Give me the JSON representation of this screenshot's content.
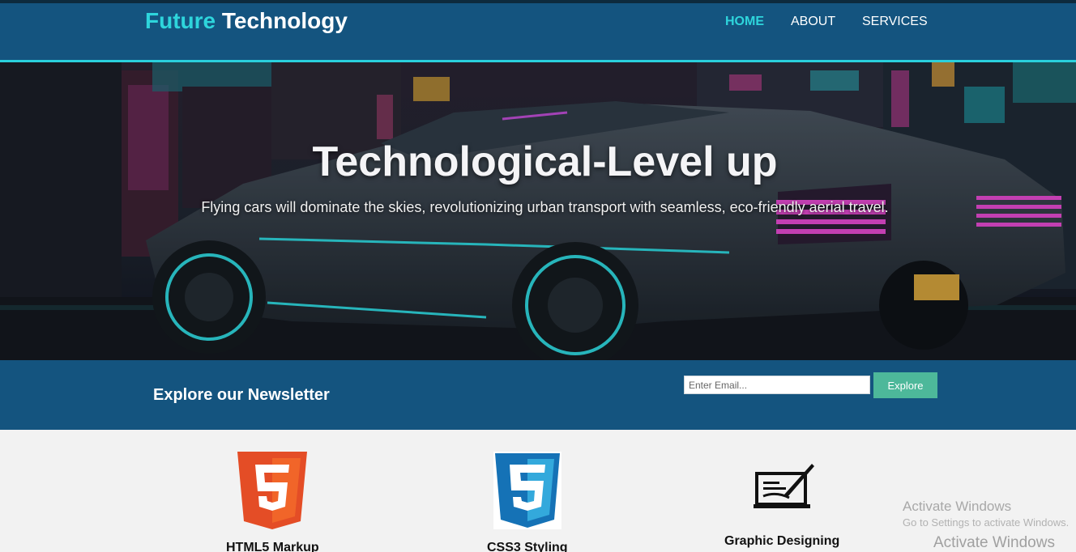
{
  "header": {
    "brand_accent": "Future",
    "brand_rest": "Technology",
    "nav": [
      {
        "label": "HOME",
        "active": true
      },
      {
        "label": "ABOUT",
        "active": false
      },
      {
        "label": "SERVICES",
        "active": false
      }
    ]
  },
  "hero": {
    "title": "Technological-Level up",
    "subtitle": "Flying cars will dominate the skies, revolutionizing urban transport with seamless, eco-friendly aerial travel.",
    "background_icon": "neon-car-street-image"
  },
  "newsletter": {
    "title": "Explore our Newsletter",
    "email_placeholder": "Enter Email...",
    "button_label": "Explore"
  },
  "services": [
    {
      "label": "HTML5 Markup",
      "icon": "html5-logo-icon"
    },
    {
      "label": "CSS3 Styling",
      "icon": "css3-logo-icon"
    },
    {
      "label": "Graphic Designing",
      "icon": "graphic-design-laptop-icon"
    }
  ],
  "watermark": {
    "line1": "Activate Windows",
    "line2": "Go to Settings to activate Windows.",
    "line3": "Activate Windows"
  },
  "colors": {
    "header_bg": "#14547f",
    "accent_cyan": "#2ed5dc",
    "button_green": "#4db89a",
    "html5_orange": "#e44d26",
    "css3_blue": "#1572b6"
  }
}
